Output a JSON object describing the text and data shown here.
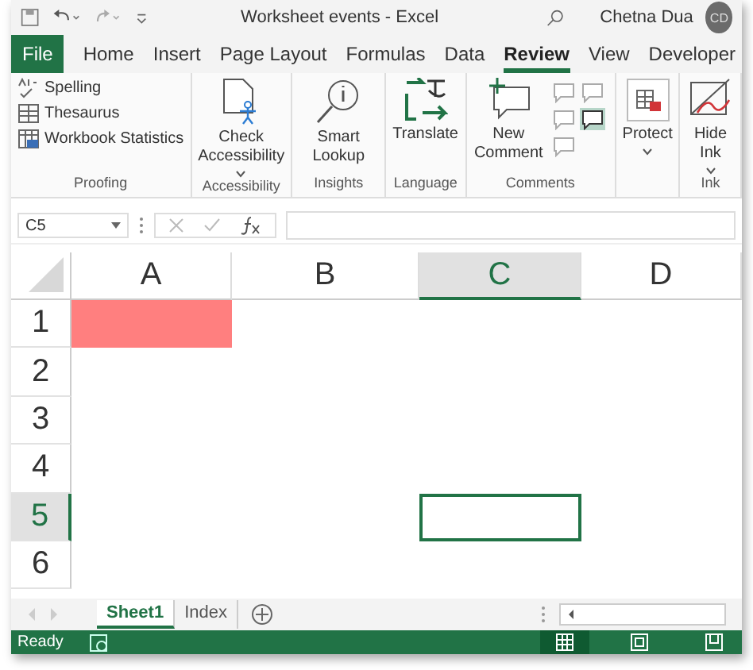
{
  "window": {
    "title": "Worksheet events - Excel",
    "user": "Chetna Dua",
    "avatar": "CD"
  },
  "file_tab": "File",
  "tabs": [
    {
      "label": "Home",
      "selected": false
    },
    {
      "label": "Insert",
      "selected": false
    },
    {
      "label": "Page Layout",
      "selected": false
    },
    {
      "label": "Formulas",
      "selected": false
    },
    {
      "label": "Data",
      "selected": false
    },
    {
      "label": "Review",
      "selected": true
    },
    {
      "label": "View",
      "selected": false
    },
    {
      "label": "Developer",
      "selected": false
    }
  ],
  "ribbon_groups": [
    {
      "kind": "list",
      "label": "Proofing",
      "commands": [
        {
          "label": "Spelling"
        },
        {
          "label": "Thesaurus"
        },
        {
          "label": "Workbook Statistics"
        }
      ]
    },
    {
      "kind": "large",
      "label": "Accessibility",
      "commands": [
        {
          "label": "Check Accessibility",
          "dropdown": true
        }
      ]
    },
    {
      "kind": "large",
      "label": "Insights",
      "commands": [
        {
          "label": "Smart Lookup"
        }
      ]
    },
    {
      "kind": "large",
      "label": "Language",
      "commands": [
        {
          "label": "Translate"
        }
      ]
    },
    {
      "kind": "comments",
      "label": "Comments",
      "commands": [
        {
          "label": "New Comment"
        }
      ]
    },
    {
      "kind": "large",
      "commands": [
        {
          "label": "Protect",
          "dropdown": true
        }
      ]
    },
    {
      "kind": "large",
      "label": "Ink",
      "commands": [
        {
          "label": "Hide Ink",
          "dropdown": true
        }
      ]
    }
  ],
  "name_box": "C5",
  "columns": [
    {
      "label": "A",
      "selected": false
    },
    {
      "label": "B",
      "selected": false
    },
    {
      "label": "C",
      "selected": true
    },
    {
      "label": "D",
      "selected": false
    }
  ],
  "rows": [
    {
      "label": "1",
      "selected": false,
      "cells": [
        {
          "color": "#ff7f7f"
        }
      ]
    },
    {
      "label": "2",
      "selected": false
    },
    {
      "label": "3",
      "selected": false
    },
    {
      "label": "4",
      "selected": false
    },
    {
      "label": "5",
      "selected": true
    },
    {
      "label": "6",
      "selected": false
    }
  ],
  "sheet_tabs": [
    {
      "label": "Sheet1",
      "selected": true
    },
    {
      "label": "Index",
      "selected": false
    }
  ],
  "status": "Ready",
  "view_buttons": [
    {
      "selected": true
    },
    {
      "selected": false
    },
    {
      "selected": false
    }
  ]
}
